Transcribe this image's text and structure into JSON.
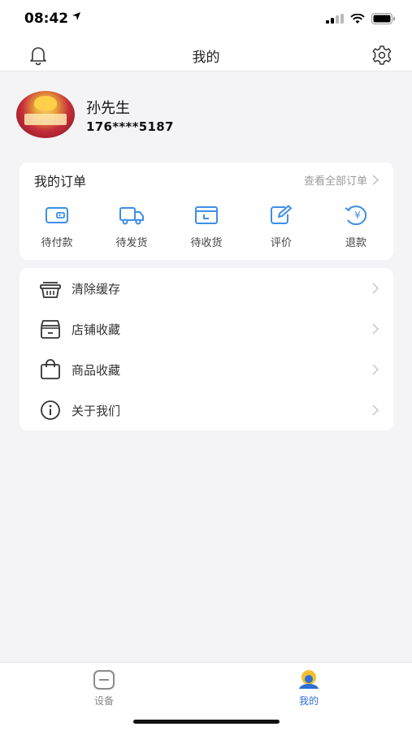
{
  "status_bar": {
    "time": "08:42"
  },
  "nav": {
    "title": "我的"
  },
  "profile": {
    "name": "孙先生",
    "phone": "176****5187"
  },
  "orders": {
    "title": "我的订单",
    "view_all": "查看全部订单",
    "items": [
      {
        "label": "待付款",
        "icon": "wallet-icon"
      },
      {
        "label": "待发货",
        "icon": "truck-icon"
      },
      {
        "label": "待收货",
        "icon": "package-icon"
      },
      {
        "label": "评价",
        "icon": "edit-icon"
      },
      {
        "label": "退款",
        "icon": "refund-yuan-icon"
      }
    ]
  },
  "menu": {
    "items": [
      {
        "label": "清除缓存",
        "icon": "basket-icon"
      },
      {
        "label": "店铺收藏",
        "icon": "store-icon"
      },
      {
        "label": "商品收藏",
        "icon": "bag-icon"
      },
      {
        "label": "关于我们",
        "icon": "info-icon"
      }
    ]
  },
  "tabs": [
    {
      "label": "设备",
      "icon": "device-icon",
      "active": false
    },
    {
      "label": "我的",
      "icon": "profile-icon",
      "active": true
    }
  ],
  "colors": {
    "accent_blue": "#3d8ee8",
    "tab_active": "#2f6fd6",
    "tab_inactive": "#8a8a8a",
    "background": "#f4f4f6"
  }
}
